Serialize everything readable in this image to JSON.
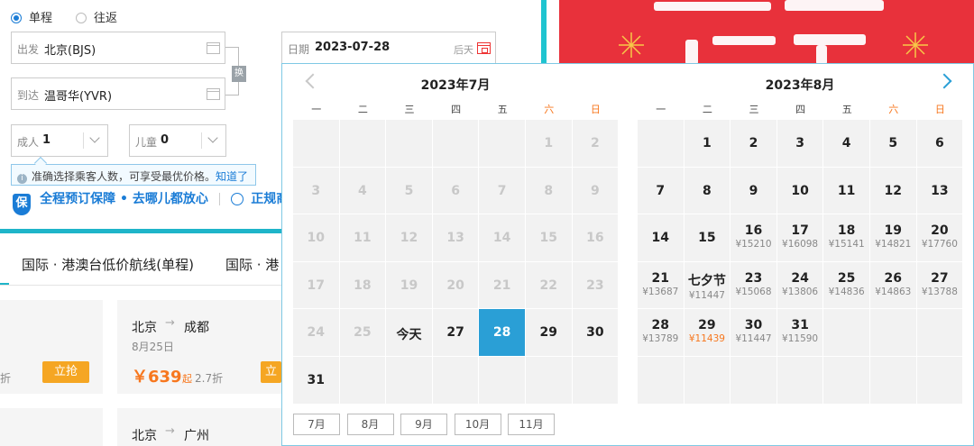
{
  "trip": {
    "oneway": "单程",
    "round": "往返"
  },
  "from": {
    "label": "出发",
    "value": "北京(BJS)"
  },
  "to": {
    "label": "到达",
    "value": "温哥华(YVR)"
  },
  "swap": "换",
  "date": {
    "label": "日期",
    "value": "2023-07-28",
    "hint": "后天"
  },
  "adult": {
    "label": "成人",
    "value": "1"
  },
  "child": {
    "label": "儿童",
    "value": "0"
  },
  "tip": {
    "text": "准确选择乘客人数，可享受最优价格。",
    "link": "知道了"
  },
  "guarantee": {
    "icon_char": "保",
    "text": "全程预订保障 • 去哪儿都放心",
    "more": "正规商"
  },
  "tabs": [
    "国际 · 港澳台低价航线(单程)",
    "国际 · 港"
  ],
  "cards": [
    {
      "grab": "立抢",
      "frag": "折"
    },
    {
      "from": "北京",
      "to": "成都",
      "date": "8月25日",
      "price": "￥639",
      "suffix": "起",
      "discount": "2.7折",
      "grab": "立"
    },
    {
      "from": "北京",
      "to": "广州"
    }
  ],
  "calendar": {
    "left": {
      "title": "2023年7月",
      "weekdays": [
        "一",
        "二",
        "三",
        "四",
        "五",
        "六",
        "日"
      ],
      "cells": [
        {
          "d": ""
        },
        {
          "d": ""
        },
        {
          "d": ""
        },
        {
          "d": ""
        },
        {
          "d": ""
        },
        {
          "d": "1",
          "s": "dis"
        },
        {
          "d": "2",
          "s": "dis"
        },
        {
          "d": "3",
          "s": "dis"
        },
        {
          "d": "4",
          "s": "dis"
        },
        {
          "d": "5",
          "s": "dis"
        },
        {
          "d": "6",
          "s": "dis"
        },
        {
          "d": "7",
          "s": "dis"
        },
        {
          "d": "8",
          "s": "dis"
        },
        {
          "d": "9",
          "s": "dis"
        },
        {
          "d": "10",
          "s": "dis"
        },
        {
          "d": "11",
          "s": "dis"
        },
        {
          "d": "12",
          "s": "dis"
        },
        {
          "d": "13",
          "s": "dis"
        },
        {
          "d": "14",
          "s": "dis"
        },
        {
          "d": "15",
          "s": "dis"
        },
        {
          "d": "16",
          "s": "dis"
        },
        {
          "d": "17",
          "s": "dis"
        },
        {
          "d": "18",
          "s": "dis"
        },
        {
          "d": "19",
          "s": "dis"
        },
        {
          "d": "20",
          "s": "dis"
        },
        {
          "d": "21",
          "s": "dis"
        },
        {
          "d": "22",
          "s": "dis"
        },
        {
          "d": "23",
          "s": "dis"
        },
        {
          "d": "24",
          "s": "dis"
        },
        {
          "d": "25",
          "s": "dis"
        },
        {
          "d": "今天"
        },
        {
          "d": "27"
        },
        {
          "d": "28",
          "s": "sel"
        },
        {
          "d": "29"
        },
        {
          "d": "30"
        },
        {
          "d": "31"
        },
        {
          "d": ""
        },
        {
          "d": ""
        },
        {
          "d": ""
        },
        {
          "d": ""
        },
        {
          "d": ""
        },
        {
          "d": ""
        }
      ]
    },
    "right": {
      "title": "2023年8月",
      "weekdays": [
        "一",
        "二",
        "三",
        "四",
        "五",
        "六",
        "日"
      ],
      "cells": [
        {
          "d": ""
        },
        {
          "d": "1"
        },
        {
          "d": "2"
        },
        {
          "d": "3"
        },
        {
          "d": "4"
        },
        {
          "d": "5"
        },
        {
          "d": "6"
        },
        {
          "d": "7"
        },
        {
          "d": "8"
        },
        {
          "d": "9"
        },
        {
          "d": "10"
        },
        {
          "d": "11"
        },
        {
          "d": "12"
        },
        {
          "d": "13"
        },
        {
          "d": "14"
        },
        {
          "d": "15"
        },
        {
          "d": "16",
          "p": "¥15210"
        },
        {
          "d": "17",
          "p": "¥16098"
        },
        {
          "d": "18",
          "p": "¥15141"
        },
        {
          "d": "19",
          "p": "¥14821"
        },
        {
          "d": "20",
          "p": "¥17760"
        },
        {
          "d": "21",
          "p": "¥13687"
        },
        {
          "d": "七夕节",
          "p": "¥11447"
        },
        {
          "d": "23",
          "p": "¥15068"
        },
        {
          "d": "24",
          "p": "¥13806"
        },
        {
          "d": "25",
          "p": "¥14836"
        },
        {
          "d": "26",
          "p": "¥14863"
        },
        {
          "d": "27",
          "p": "¥13788"
        },
        {
          "d": "28",
          "p": "¥13789"
        },
        {
          "d": "29",
          "p": "¥11439",
          "low": true
        },
        {
          "d": "30",
          "p": "¥11447"
        },
        {
          "d": "31",
          "p": "¥11590"
        },
        {
          "d": ""
        },
        {
          "d": ""
        },
        {
          "d": ""
        },
        {
          "d": ""
        },
        {
          "d": ""
        },
        {
          "d": ""
        },
        {
          "d": ""
        },
        {
          "d": ""
        },
        {
          "d": ""
        },
        {
          "d": ""
        }
      ]
    },
    "months": [
      "7月",
      "8月",
      "9月",
      "10月",
      "11月"
    ]
  },
  "colors": {
    "accent": "#2a9fd6",
    "teal": "#1fb5c9",
    "orange": "#f7771e",
    "banner": "#e8313b"
  }
}
